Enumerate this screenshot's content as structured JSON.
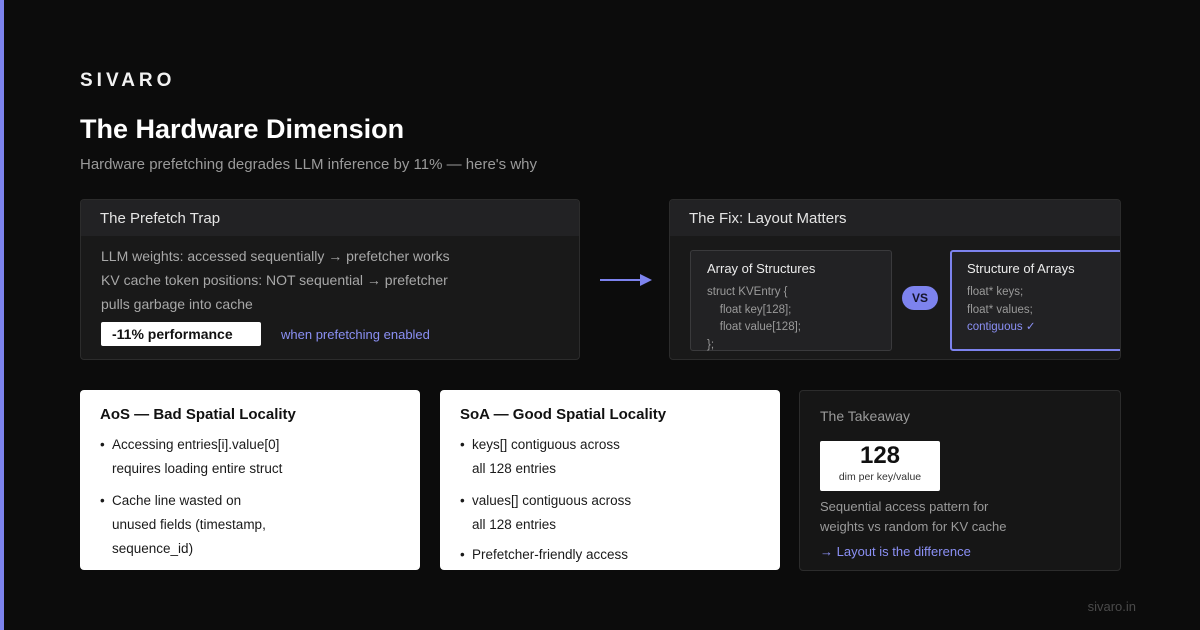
{
  "brand": "SIVARO",
  "title": "The Hardware Dimension",
  "subtitle": "Hardware prefetching degrades LLM inference by 11% — here's why",
  "trap": {
    "heading": "The Prefetch Trap",
    "lines": [
      "LLM weights: accessed sequentially → prefetcher works",
      "KV cache token positions: NOT sequential → prefetcher",
      "pulls garbage into cache"
    ],
    "badge": "-11% performance",
    "note": "when prefetching enabled"
  },
  "fix": {
    "heading": "The Fix: Layout Matters",
    "aos": {
      "title": "Array of Structures",
      "code": [
        "struct KVEntry {",
        "    float key[128];",
        "    float value[128];",
        "};"
      ]
    },
    "vs": "VS",
    "soa": {
      "title": "Structure of Arrays",
      "code": [
        "float* keys;",
        "float* values;"
      ],
      "highlight": "contiguous ✓"
    }
  },
  "aos_card": {
    "title": "AoS — Bad Spatial Locality",
    "bullets": [
      [
        "Accessing entries[i].value[0]",
        "requires loading entire struct"
      ],
      [
        "Cache line wasted on",
        "unused fields (timestamp,",
        "sequence_id)"
      ]
    ]
  },
  "soa_card": {
    "title": "SoA — Good Spatial Locality",
    "bullets": [
      [
        "keys[] contiguous across",
        "all 128 entries"
      ],
      [
        "values[] contiguous across",
        "all 128 entries"
      ],
      [
        "Prefetcher-friendly access"
      ]
    ]
  },
  "takeaway": {
    "heading": "The Takeaway",
    "stat_value": "128",
    "stat_label": "dim per key/value",
    "text": [
      "Sequential access pattern for",
      "weights vs random for KV cache"
    ],
    "link": "→ Layout is the difference"
  },
  "footer": "sivaro.in",
  "colors": {
    "accent": "#7d83ee",
    "background": "#0c0c0c",
    "card": "#191919"
  }
}
